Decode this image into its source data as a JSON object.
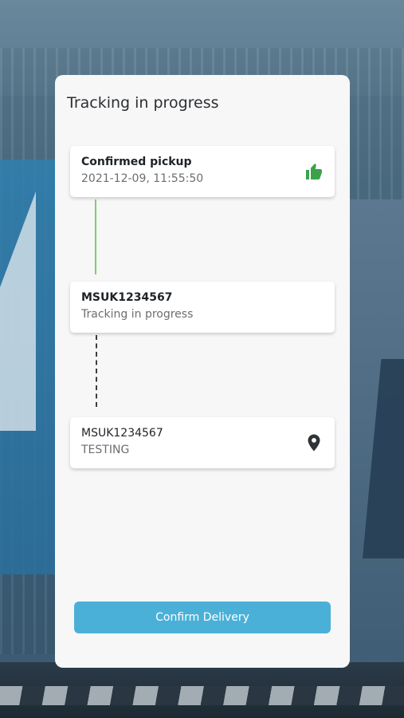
{
  "card": {
    "title": "Tracking in progress"
  },
  "steps": [
    {
      "line1": "Confirmed pickup",
      "line2": "2021-12-09, 11:55:50",
      "icon": "thumbs-up-icon",
      "icon_color": "#3aa24a"
    },
    {
      "line1": "MSUK1234567",
      "line2": "Tracking in progress"
    },
    {
      "line1": "MSUK1234567",
      "line2": "TESTING",
      "icon": "location-pin-icon",
      "icon_color": "#2f3236"
    }
  ],
  "connectors": [
    {
      "style": "solid",
      "color": "#7fcf6a"
    },
    {
      "style": "dashed",
      "color": "#3a3d40"
    }
  ],
  "actions": {
    "confirm_label": "Confirm Delivery",
    "confirm_color": "#4bb0d8"
  }
}
